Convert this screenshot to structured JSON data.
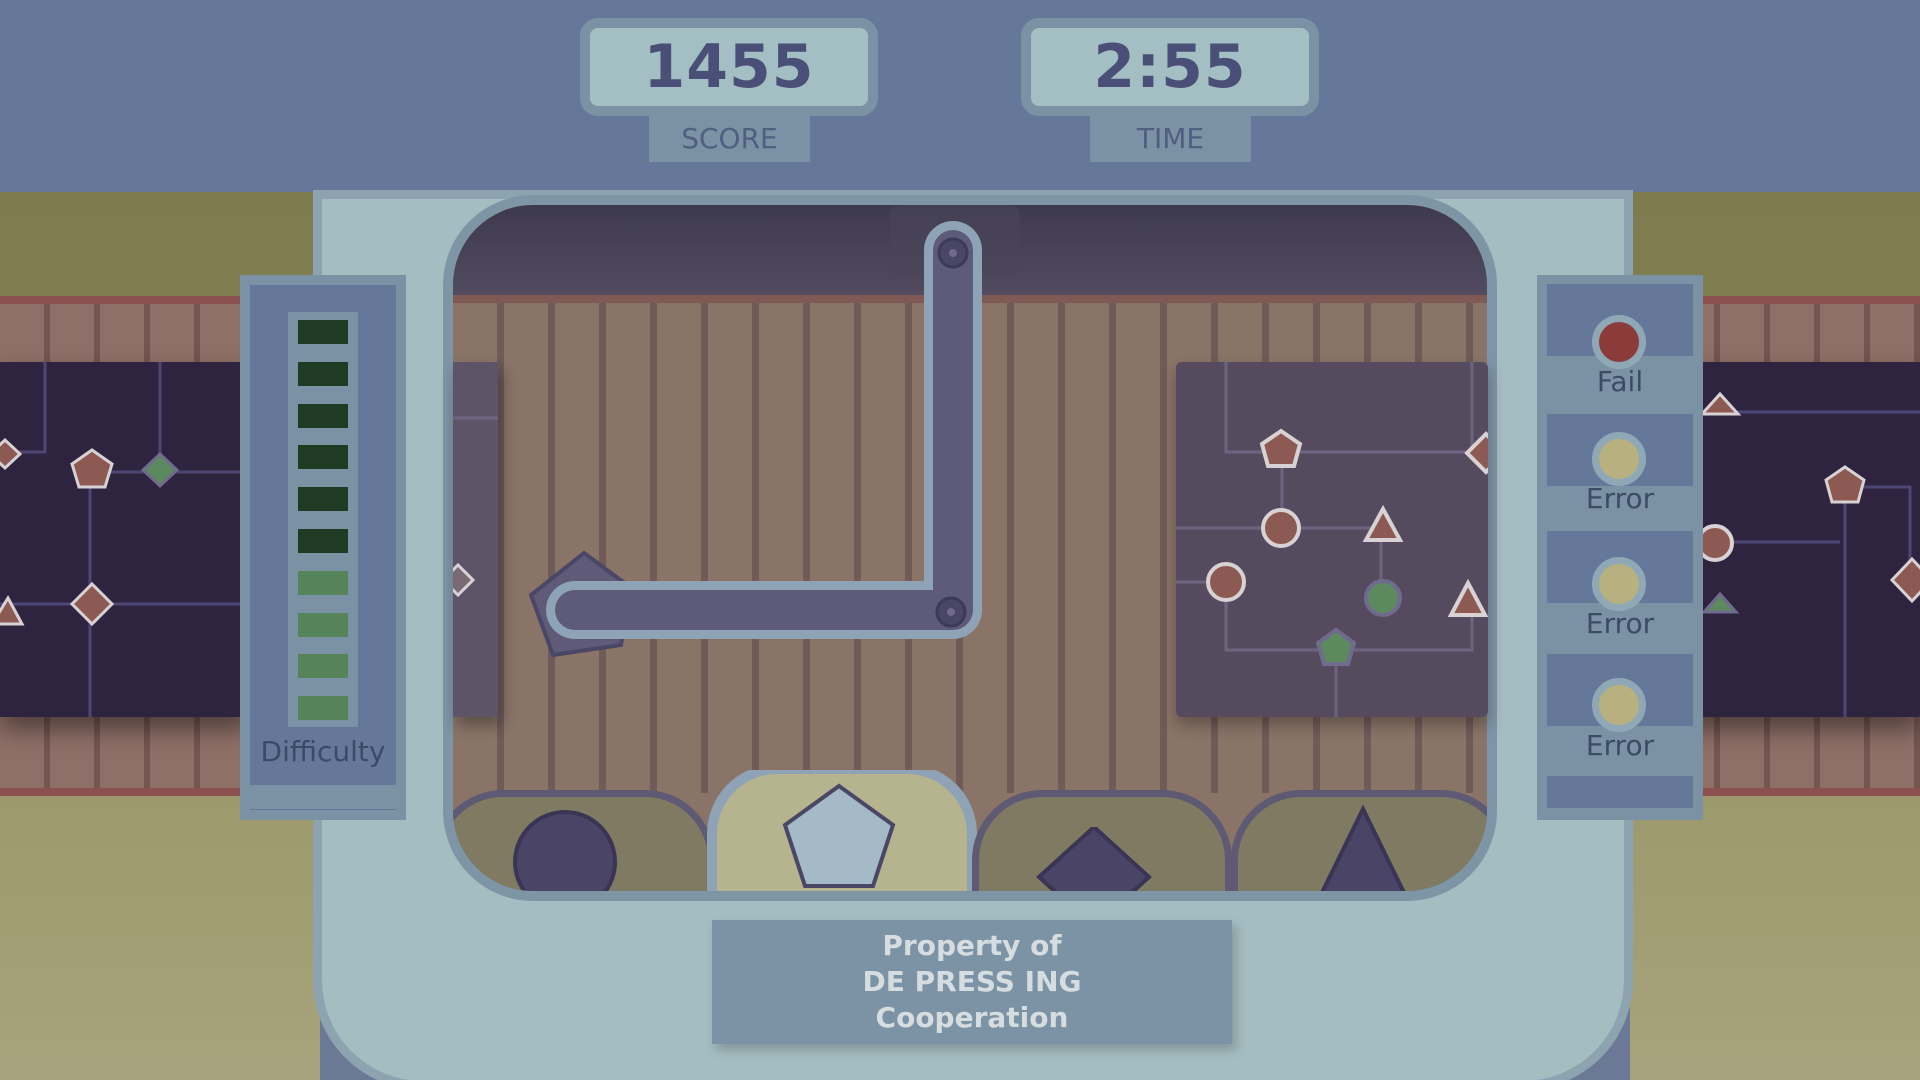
{
  "hud": {
    "score_value": "1455",
    "score_label": "SCORE",
    "time_value": "2:55",
    "time_label": "TIME"
  },
  "difficulty": {
    "label": "Difficulty",
    "total_bars": 10,
    "filled_dark_bars": 6,
    "dark_color": "#1f3b24",
    "light_color": "#55845a"
  },
  "status": [
    {
      "label": "Fail",
      "light_color": "#8c3b3b"
    },
    {
      "label": "Error",
      "light_color": "#b8b07e"
    },
    {
      "label": "Error",
      "light_color": "#b8b07e"
    },
    {
      "label": "Error",
      "light_color": "#b8b07e"
    }
  ],
  "shape_selector": {
    "options": [
      "circle",
      "pentagon",
      "diamond",
      "triangle"
    ],
    "selected": "pentagon"
  },
  "plaque": {
    "line1": "Property of",
    "line2": "DE PRESS ING",
    "line3": "Cooperation"
  },
  "colors": {
    "panel": "#66789a",
    "frame": "#a4bdc0",
    "accent_text": "#4a4f78",
    "pipe": "#5d5a7a",
    "node_red": "#8c5a52",
    "node_green": "#5c8a5e"
  }
}
